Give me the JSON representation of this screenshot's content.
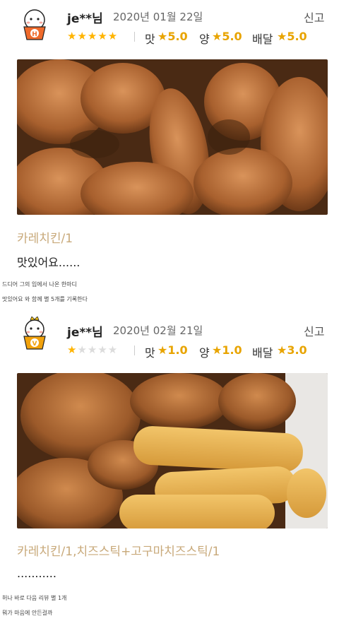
{
  "reviews": [
    {
      "badge": "H",
      "badge_color": "#ef6a2b",
      "user": "je**님",
      "date": "2020년 01월 22일",
      "report": "신고",
      "stars": "★★★★★",
      "star_rating": 5,
      "rating_taste_label": "맛",
      "rating_taste": "★5.0",
      "rating_amount_label": "양",
      "rating_amount": "★5.0",
      "rating_delivery_label": "배달",
      "rating_delivery": "★5.0",
      "menu": "카레치킨/1",
      "comment": "맛있어요......",
      "caption1": "드디어 그의 입에서 나온 한마디",
      "caption2": "맛있어요 와 함께 별 5개를 기록한다"
    },
    {
      "badge": "V",
      "badge_color": "#f2a20c",
      "user": "je**님",
      "date": "2020년 02월 21일",
      "report": "신고",
      "stars_filled": "★",
      "stars_empty": "★★★★",
      "star_rating": 1,
      "rating_taste_label": "맛",
      "rating_taste": "★1.0",
      "rating_amount_label": "양",
      "rating_amount": "★1.0",
      "rating_delivery_label": "배달",
      "rating_delivery": "★3.0",
      "menu": "카레치킨/1,치즈스틱+고구마치즈스틱/1",
      "comment": "...........",
      "caption1": "허나 바로 다음 리뷰 별 1개",
      "caption2": "뭐가 마음에 안든걸까"
    }
  ],
  "colors": {
    "star": "#ffb400",
    "star_empty": "#dcdcdc",
    "menu": "#c8a97a"
  }
}
